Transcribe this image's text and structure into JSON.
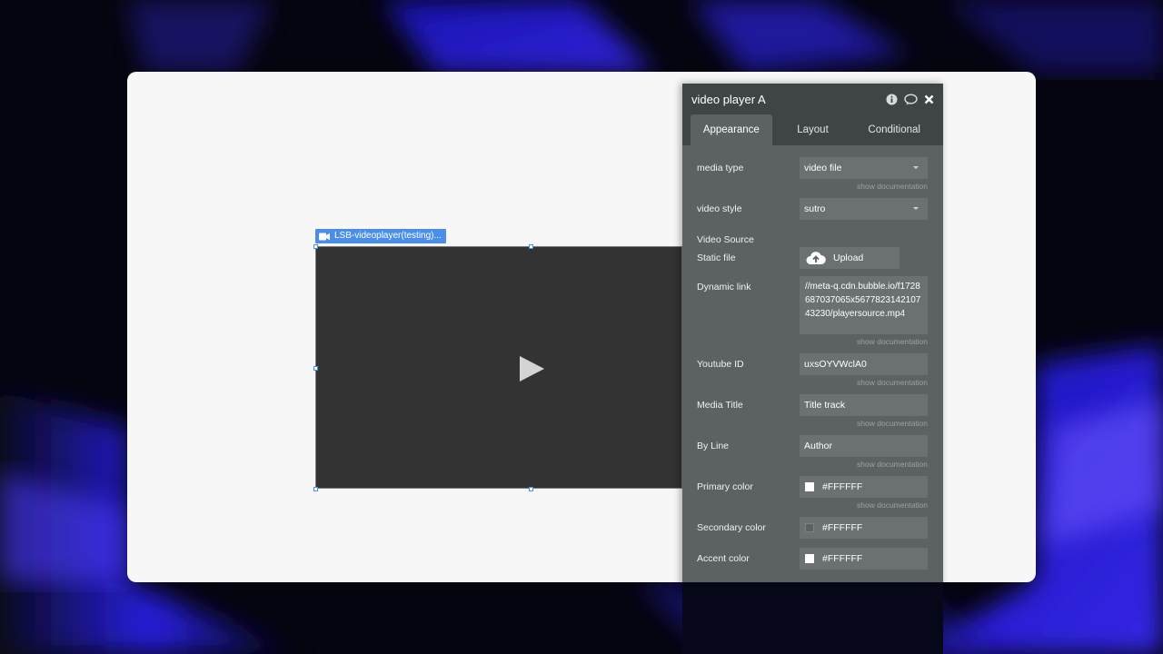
{
  "element_tag": {
    "label": "LSB-videoplayer(testing)..."
  },
  "panel": {
    "title": "video player A",
    "tabs": [
      {
        "label": "Appearance",
        "active": true
      },
      {
        "label": "Layout",
        "active": false
      },
      {
        "label": "Conditional",
        "active": false
      }
    ],
    "media_type": {
      "label": "media type",
      "value": "video file"
    },
    "video_style": {
      "label": "video style",
      "value": "sutro"
    },
    "video_source": {
      "heading": "Video Source"
    },
    "static_file": {
      "label": "Static file",
      "button": "Upload"
    },
    "dynamic_link": {
      "label": "Dynamic link",
      "value": "//meta-q.cdn.bubble.io/f1728687037065x567782314210743230/playersource.mp4"
    },
    "youtube_id": {
      "label": "Youtube ID",
      "value": "uxsOYVWclA0"
    },
    "media_title": {
      "label": "Media Title",
      "value": "Title track"
    },
    "by_line": {
      "label": "By Line",
      "value": "Author"
    },
    "primary_color": {
      "label": "Primary color",
      "value": "#FFFFFF"
    },
    "secondary_color": {
      "label": "Secondary color",
      "value": "#FFFFFF"
    },
    "accent_color": {
      "label": "Accent color",
      "value": "#FFFFFF"
    },
    "doc_link": "show documentation"
  },
  "colors": {
    "selection_blue": "#4a8ee8",
    "panel_bg": "#5c6163",
    "panel_header": "#3f4446",
    "video_bg": "#333333"
  },
  "icons": [
    "video-camera-icon",
    "play-icon",
    "info-icon",
    "comment-icon",
    "close-icon",
    "cloud-upload-icon",
    "chevron-down-icon"
  ]
}
